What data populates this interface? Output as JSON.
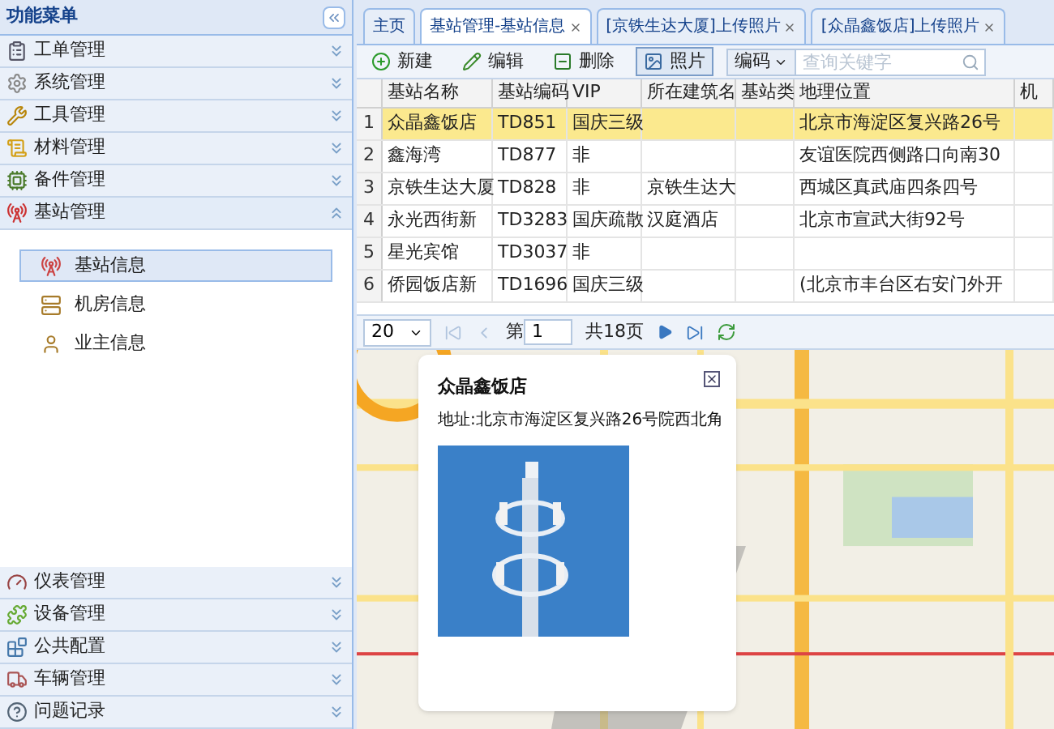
{
  "sidebar": {
    "title": "功能菜单",
    "groups": [
      {
        "label": "工单管理",
        "expanded": false
      },
      {
        "label": "系统管理",
        "expanded": false
      },
      {
        "label": "工具管理",
        "expanded": false
      },
      {
        "label": "材料管理",
        "expanded": false
      },
      {
        "label": "备件管理",
        "expanded": false
      },
      {
        "label": "基站管理",
        "expanded": true,
        "items": [
          {
            "label": "基站信息",
            "selected": true
          },
          {
            "label": "机房信息",
            "selected": false
          },
          {
            "label": "业主信息",
            "selected": false
          }
        ]
      },
      {
        "label": "仪表管理",
        "expanded": false
      },
      {
        "label": "设备管理",
        "expanded": false
      },
      {
        "label": "公共配置",
        "expanded": false
      },
      {
        "label": "车辆管理",
        "expanded": false
      },
      {
        "label": "问题记录",
        "expanded": false
      }
    ]
  },
  "tabs": [
    {
      "label": "主页",
      "selected": false,
      "closable": false
    },
    {
      "label": "基站管理-基站信息",
      "selected": true,
      "closable": true
    },
    {
      "label": "[京铁生达大厦]上传照片",
      "selected": false,
      "closable": true
    },
    {
      "label": "[众晶鑫饭店]上传照片",
      "selected": false,
      "closable": true
    }
  ],
  "toolbar": {
    "buttons": [
      {
        "label": "新建",
        "pressed": false
      },
      {
        "label": "编辑",
        "pressed": false
      },
      {
        "label": "删除",
        "pressed": false
      },
      {
        "label": "照片",
        "pressed": true
      }
    ],
    "search_field": {
      "value": "编码",
      "placeholder": "查询关键字"
    }
  },
  "table": {
    "columns": [
      "基站名称",
      "基站编码",
      "VIP",
      "所在建筑名",
      "基站类",
      "地理位置",
      "机"
    ],
    "rows": [
      {
        "index": "1",
        "selected": true,
        "cells": [
          "众晶鑫饭店",
          "TD851",
          "国庆三级",
          "",
          "",
          "北京市海淀区复兴路26号",
          ""
        ]
      },
      {
        "index": "2",
        "selected": false,
        "cells": [
          "鑫海湾",
          "TD877",
          "非",
          "",
          "",
          "友谊医院西侧路口向南30",
          ""
        ]
      },
      {
        "index": "3",
        "selected": false,
        "cells": [
          "京铁生达大厦",
          "TD828",
          "非",
          "京铁生达大",
          "",
          "西城区真武庙四条四号",
          ""
        ]
      },
      {
        "index": "4",
        "selected": false,
        "cells": [
          "永光西街新",
          "TD3283",
          "国庆疏散",
          "汉庭酒店",
          "",
          "北京市宣武大街92号",
          ""
        ]
      },
      {
        "index": "5",
        "selected": false,
        "cells": [
          "星光宾馆",
          "TD3037",
          "非",
          "",
          "",
          "",
          ""
        ]
      },
      {
        "index": "6",
        "selected": false,
        "cells": [
          "侨园饭店新",
          "TD1696",
          "国庆三级",
          "",
          "",
          "(北京市丰台区右安门外开",
          ""
        ]
      }
    ]
  },
  "pager": {
    "page_size": "20",
    "page_label": "第",
    "page": "1",
    "total": "共18页"
  },
  "map": {
    "popup": {
      "title": "众晶鑫饭店",
      "address": "地址:北京市海淀区复兴路26号院西北角"
    }
  }
}
